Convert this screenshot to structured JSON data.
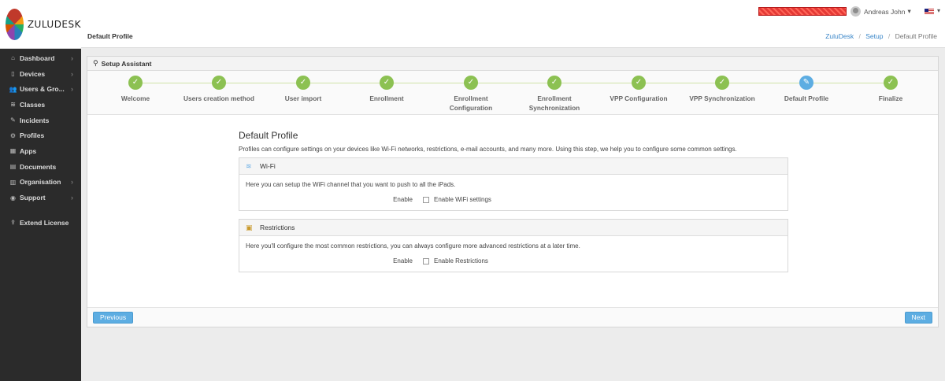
{
  "app": {
    "logo_text": "ZULUDESK"
  },
  "sidebar": {
    "items": [
      {
        "label": "Dashboard",
        "icon": "home-icon",
        "glyph": "⌂",
        "chevron": true
      },
      {
        "label": "Devices",
        "icon": "device-icon",
        "glyph": "▯",
        "chevron": true
      },
      {
        "label": "Users & Gro...",
        "icon": "users-icon",
        "glyph": "👥",
        "chevron": true
      },
      {
        "label": "Classes",
        "icon": "classes-icon",
        "glyph": "≋",
        "chevron": false
      },
      {
        "label": "Incidents",
        "icon": "wrench-icon",
        "glyph": "✎",
        "chevron": false
      },
      {
        "label": "Profiles",
        "icon": "gears-icon",
        "glyph": "⚙",
        "chevron": false
      },
      {
        "label": "Apps",
        "icon": "apps-icon",
        "glyph": "▦",
        "chevron": false
      },
      {
        "label": "Documents",
        "icon": "documents-icon",
        "glyph": "▤",
        "chevron": false
      },
      {
        "label": "Organisation",
        "icon": "building-icon",
        "glyph": "▥",
        "chevron": true
      },
      {
        "label": "Support",
        "icon": "support-icon",
        "glyph": "◉",
        "chevron": true
      }
    ],
    "extend": {
      "label": "Extend License",
      "icon": "upload-icon",
      "glyph": "⇪"
    }
  },
  "topbar": {
    "user_name": "Andreas John",
    "user_chevron": "▾",
    "flag_chevron": "▾"
  },
  "header": {
    "title": "Default Profile",
    "breadcrumb": {
      "root": "ZuluDesk",
      "middle": "Setup",
      "current": "Default Profile",
      "sep": "/"
    }
  },
  "panel": {
    "title": "Setup Assistant",
    "icon": "wrench-icon"
  },
  "wizard": {
    "steps": [
      {
        "line1": "Welcome",
        "line2": "",
        "state": "done"
      },
      {
        "line1": "Users creation method",
        "line2": "",
        "state": "done"
      },
      {
        "line1": "User import",
        "line2": "",
        "state": "done"
      },
      {
        "line1": "Enrollment",
        "line2": "",
        "state": "done"
      },
      {
        "line1": "Enrollment",
        "line2": "Configuration",
        "state": "done"
      },
      {
        "line1": "Enrollment",
        "line2": "Synchronization",
        "state": "done"
      },
      {
        "line1": "VPP Configuration",
        "line2": "",
        "state": "done"
      },
      {
        "line1": "VPP Synchronization",
        "line2": "",
        "state": "done"
      },
      {
        "line1": "Default Profile",
        "line2": "",
        "state": "current"
      },
      {
        "line1": "Finalize",
        "line2": "",
        "state": "done"
      }
    ],
    "done_glyph": "✓",
    "current_glyph": "✎",
    "colors": {
      "done": "#8cc152",
      "current": "#5dade2"
    }
  },
  "content": {
    "title": "Default Profile",
    "description": "Profiles can configure settings on your devices like Wi-Fi networks, restrictions, e-mail accounts, and many more. Using this step, we help you to configure some common settings.",
    "wifi": {
      "title": "Wi-Fi",
      "icon": "wifi-icon",
      "text": "Here you can setup the WiFi channel that you want to push to all the iPads.",
      "field_label": "Enable",
      "checkbox_label": "Enable WiFi settings",
      "checked": false
    },
    "restrictions": {
      "title": "Restrictions",
      "icon": "lock-icon",
      "text": "Here you'll configure the most common restrictions, you can always configure more advanced restrictions at a later time.",
      "field_label": "Enable",
      "checkbox_label": "Enable Restrictions",
      "checked": false
    }
  },
  "footer": {
    "previous_label": "Previous",
    "next_label": "Next"
  }
}
